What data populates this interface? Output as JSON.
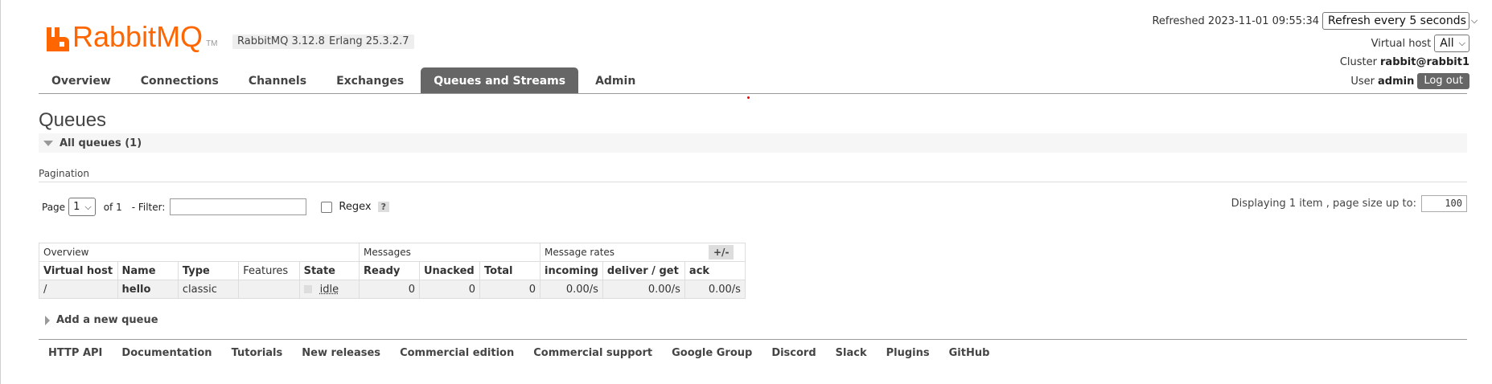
{
  "brand": {
    "name": "RabbitMQ",
    "tm": "TM",
    "color": "#ff6600"
  },
  "versions": {
    "rabbitmq": "RabbitMQ 3.12.8",
    "erlang": "Erlang 25.3.2.7"
  },
  "top_right": {
    "refreshed": "Refreshed 2023-11-01 09:55:34",
    "refresh_select": "Refresh every 5 seconds",
    "vhost_label": "Virtual host",
    "vhost_select": "All",
    "cluster_label": "Cluster",
    "cluster_value": "rabbit@rabbit1",
    "user_label": "User",
    "user_value": "admin",
    "logout": "Log out"
  },
  "tabs": [
    {
      "label": "Overview",
      "active": false
    },
    {
      "label": "Connections",
      "active": false
    },
    {
      "label": "Channels",
      "active": false
    },
    {
      "label": "Exchanges",
      "active": false
    },
    {
      "label": "Queues and Streams",
      "active": true
    },
    {
      "label": "Admin",
      "active": false
    }
  ],
  "page_title": "Queues",
  "section": {
    "label": "All queues (1)"
  },
  "pagination": {
    "label": "Pagination",
    "page_label": "Page",
    "page_value": "1",
    "of_label": "of 1",
    "filter_label": "- Filter:",
    "regex_label": "Regex",
    "help": "?",
    "displaying": "Displaying 1 item , page size up to:",
    "page_size": "100"
  },
  "table": {
    "groups": [
      "Overview",
      "Messages",
      "Message rates"
    ],
    "plus_minus": "+/-",
    "headers": [
      "Virtual host",
      "Name",
      "Type",
      "Features",
      "State",
      "Ready",
      "Unacked",
      "Total",
      "incoming",
      "deliver / get",
      "ack"
    ],
    "rows": [
      [
        "/",
        "hello",
        "classic",
        "",
        "idle",
        "0",
        "0",
        "0",
        "0.00/s",
        "0.00/s",
        "0.00/s"
      ]
    ]
  },
  "add_queue": "Add a new queue",
  "footer": [
    "HTTP API",
    "Documentation",
    "Tutorials",
    "New releases",
    "Commercial edition",
    "Commercial support",
    "Google Group",
    "Discord",
    "Slack",
    "Plugins",
    "GitHub"
  ]
}
